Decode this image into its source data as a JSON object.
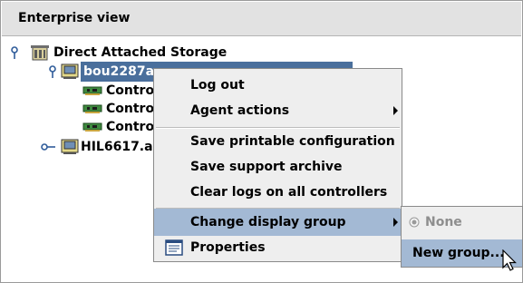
{
  "panel": {
    "title": "Enterprise view"
  },
  "tree": {
    "root": {
      "label": "Direct Attached Storage",
      "icon": "storage-building-icon",
      "expanded": true
    },
    "server1": {
      "label": "bou2287a",
      "icon": "server-icon",
      "expanded": true,
      "selected": true
    },
    "controllers": [
      {
        "label": "Contro",
        "icon": "controller-card-icon"
      },
      {
        "label": "Contro",
        "icon": "controller-card-icon"
      },
      {
        "label": "Contro",
        "icon": "controller-card-icon"
      }
    ],
    "server2": {
      "label": "HIL6617.ac",
      "icon": "server-icon",
      "expanded": false
    }
  },
  "context_menu": {
    "items": [
      {
        "label": "Log out"
      },
      {
        "label": "Agent actions",
        "submenu": true
      },
      {
        "label": "Save printable configuration"
      },
      {
        "label": "Save support archive"
      },
      {
        "label": "Clear logs on all controllers"
      },
      {
        "label": "Change display group",
        "submenu": true,
        "active": true
      },
      {
        "label": "Properties",
        "icon": "properties-document-icon"
      }
    ]
  },
  "submenu": {
    "items": [
      {
        "label": "None",
        "type": "radio",
        "selected": true,
        "disabled": true
      },
      {
        "label": "New group...",
        "active": true
      }
    ]
  },
  "colors": {
    "selection": "#4a6f9c",
    "menu_highlight": "#a3b9d4",
    "header_bg": "#e2e2e2",
    "menu_bg": "#eeeeee"
  }
}
